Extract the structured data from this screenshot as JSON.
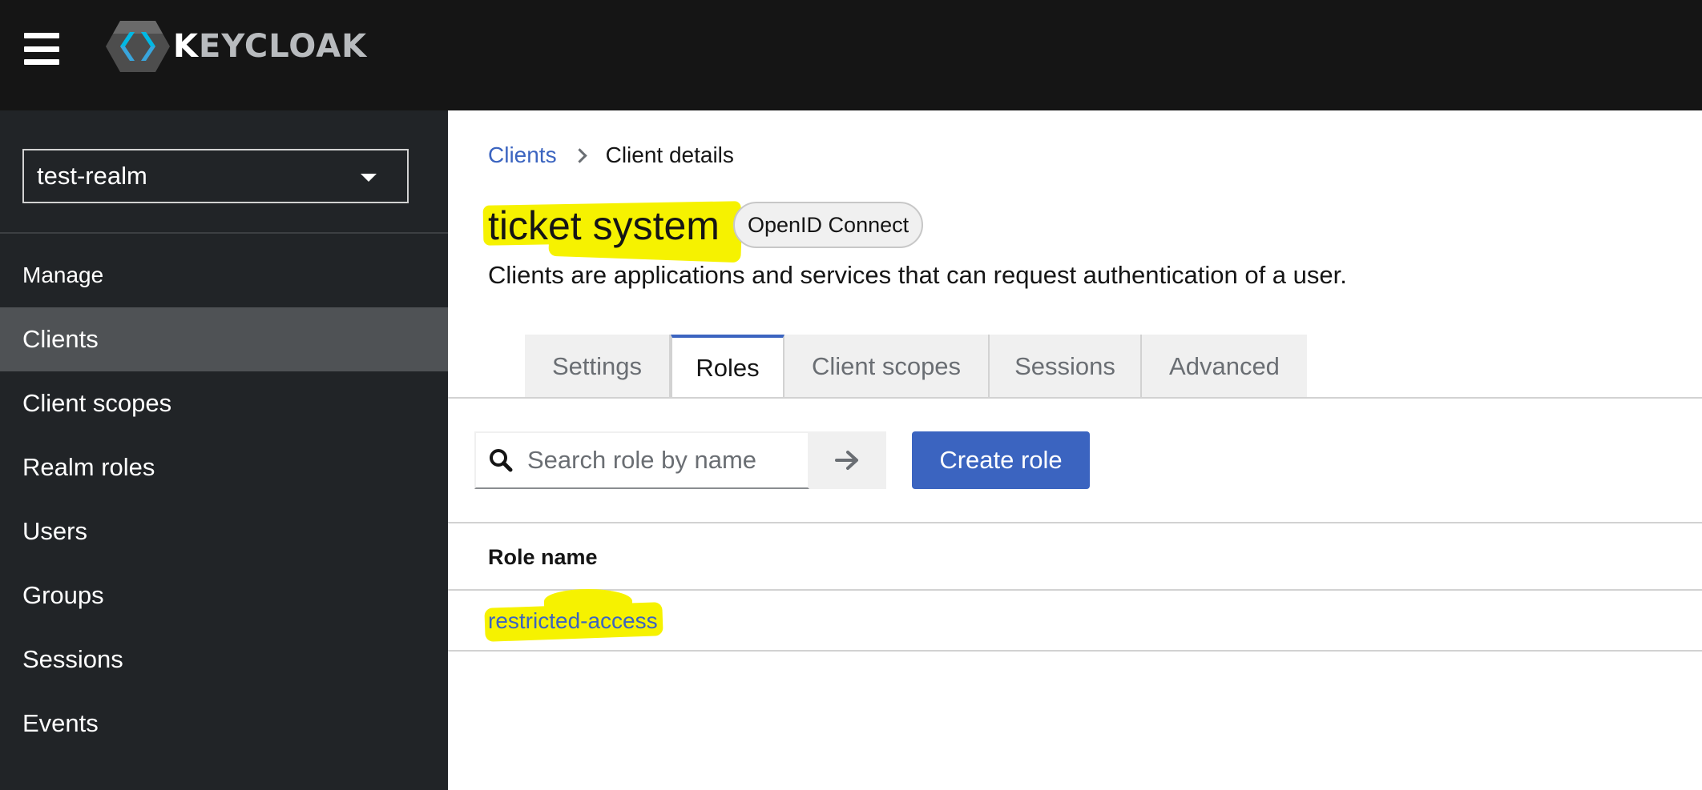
{
  "brand": {
    "logo_letter": "K",
    "logo_rest": "EYCLOAK"
  },
  "realm_selector": {
    "value": "test-realm"
  },
  "sidebar": {
    "section_title": "Manage",
    "items": [
      {
        "label": "Clients",
        "active": true
      },
      {
        "label": "Client scopes",
        "active": false
      },
      {
        "label": "Realm roles",
        "active": false
      },
      {
        "label": "Users",
        "active": false
      },
      {
        "label": "Groups",
        "active": false
      },
      {
        "label": "Sessions",
        "active": false
      },
      {
        "label": "Events",
        "active": false
      }
    ]
  },
  "breadcrumb": {
    "link": "Clients",
    "current": "Client details"
  },
  "header": {
    "title": "ticket system",
    "badge": "OpenID Connect",
    "subtitle": "Clients are applications and services that can request authentication of a user."
  },
  "tabs": [
    {
      "label": "Settings",
      "active": false
    },
    {
      "label": "Roles",
      "active": true
    },
    {
      "label": "Client scopes",
      "active": false
    },
    {
      "label": "Sessions",
      "active": false
    },
    {
      "label": "Advanced",
      "active": false
    }
  ],
  "toolbar": {
    "search_placeholder": "Search role by name",
    "create_label": "Create role"
  },
  "table": {
    "columns": [
      "Role name"
    ],
    "rows": [
      {
        "role_name": "restricted-access"
      }
    ]
  },
  "colors": {
    "topbar": "#151515",
    "sidebar": "#212427",
    "sidebar_active": "#4f5255",
    "accent": "#3b64c0",
    "highlight": "#f6f200"
  }
}
